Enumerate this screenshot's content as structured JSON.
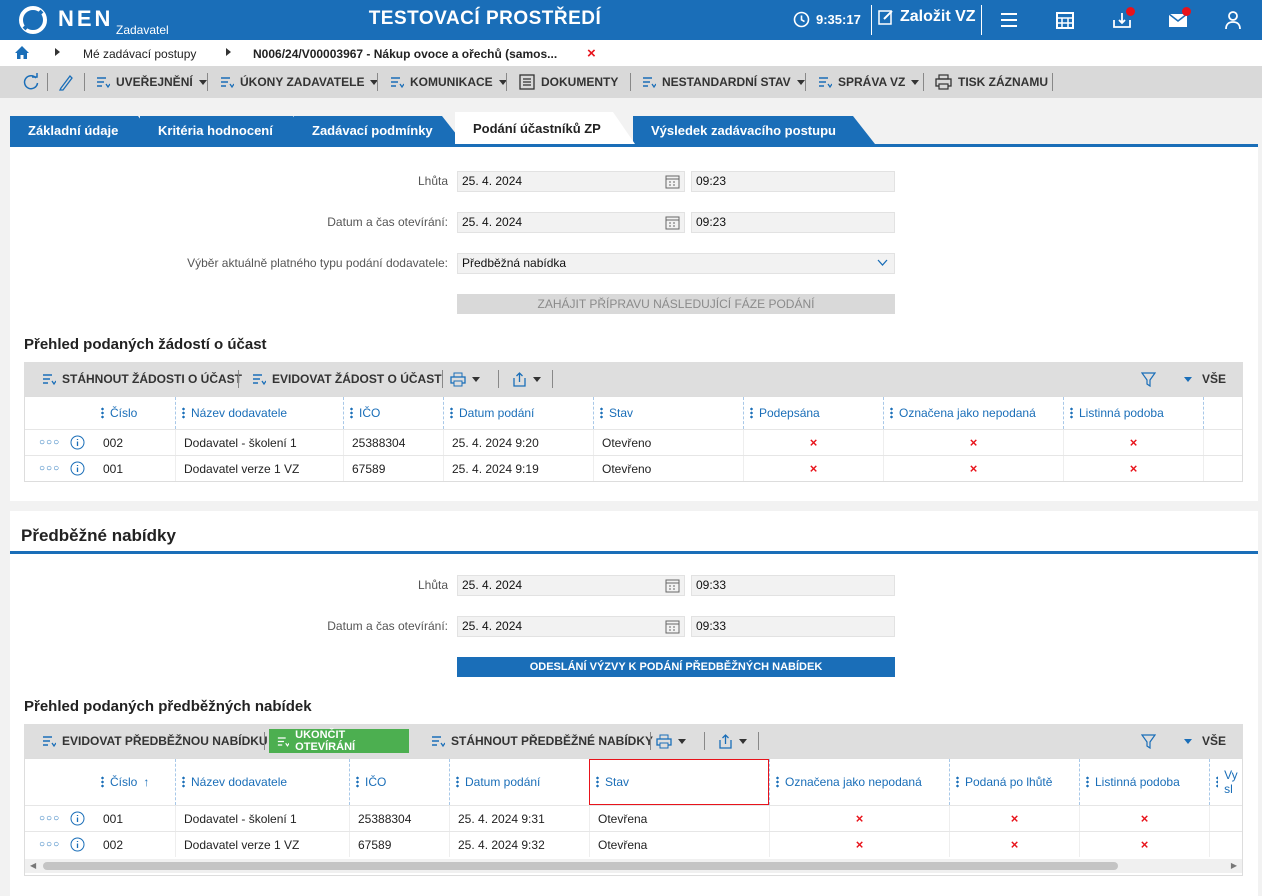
{
  "header": {
    "logo": "NEN",
    "logo_sub": "Zadavatel",
    "environment": "TESTOVACÍ PROSTŘEDÍ",
    "clock": "9:35:17",
    "new_button": "Založit VZ"
  },
  "breadcrumb": {
    "item1": "Mé zadávací postupy",
    "item2": "N006/24/V00003967 - Nákup ovoce a ořechů (samos..."
  },
  "toolbar": {
    "publish": "UVEŘEJNĚNÍ",
    "actions": "ÚKONY ZADAVATELE",
    "communication": "KOMUNIKACE",
    "documents": "DOKUMENTY",
    "nonstandard": "NESTANDARDNÍ STAV",
    "manage": "SPRÁVA VZ",
    "print": "TISK ZÁZNAMU"
  },
  "tabs": [
    "Základní údaje",
    "Kritéria hodnocení",
    "Zadávací podmínky",
    "Podání účastníků ZP",
    "Výsledek zadávacího postupu"
  ],
  "section1": {
    "deadline_label": "Lhůta",
    "deadline_date": "25. 4. 2024",
    "deadline_time": "09:23",
    "open_label": "Datum a čas otevírání:",
    "open_date": "25. 4. 2024",
    "open_time": "09:23",
    "type_label": "Výběr aktuálně platného typu podání dodavatele:",
    "type_value": "Předběžná nabídka",
    "prepare_button": "ZAHÁJIT PŘÍPRAVU NÁSLEDUJÍCÍ FÁZE PODÁNÍ",
    "grid_title": "Přehled podaných žádostí o účast",
    "btn_download": "STÁHNOUT ŽÁDOSTI O ÚČAST",
    "btn_register": "EVIDOVAT ŽÁDOST O ÚČAST",
    "all": "VŠE",
    "columns": [
      "Číslo",
      "Název dodavatele",
      "IČO",
      "Datum podání",
      "Stav",
      "Podepsána",
      "Označena jako nepodaná",
      "Listinná podoba"
    ],
    "rows": [
      {
        "num": "002",
        "name": "Dodavatel - školení 1",
        "ico": "25388304",
        "date": "25. 4. 2024 9:20",
        "state": "Otevřeno"
      },
      {
        "num": "001",
        "name": "Dodavatel verze 1 VZ",
        "ico": "67589",
        "date": "25. 4. 2024 9:19",
        "state": "Otevřeno"
      }
    ]
  },
  "section2": {
    "title": "Předběžné nabídky",
    "deadline_label": "Lhůta",
    "deadline_date": "25. 4. 2024",
    "deadline_time": "09:33",
    "open_label": "Datum a čas otevírání:",
    "open_date": "25. 4. 2024",
    "open_time": "09:33",
    "send_button": "ODESLÁNÍ VÝZVY K PODÁNÍ PŘEDBĚŽNÝCH NABÍDEK",
    "grid_title": "Přehled podaných předběžných nabídek",
    "btn_register": "EVIDOVAT PŘEDBĚŽNOU NABÍDKU",
    "btn_finish": "UKONČIT OTEVÍRÁNÍ",
    "btn_download": "STÁHNOUT PŘEDBĚŽNÉ NABÍDKY",
    "all": "VŠE",
    "columns": [
      "Číslo",
      "Název dodavatele",
      "IČO",
      "Datum podání",
      "Stav",
      "Označena jako nepodaná",
      "Podaná po lhůtě",
      "Listinná podoba",
      "Vy sl"
    ],
    "rows": [
      {
        "num": "001",
        "name": "Dodavatel - školení 1",
        "ico": "25388304",
        "date": "25. 4. 2024 9:31",
        "state": "Otevřena"
      },
      {
        "num": "002",
        "name": "Dodavatel verze 1 VZ",
        "ico": "67589",
        "date": "25. 4. 2024 9:32",
        "state": "Otevřena"
      }
    ]
  },
  "mark": "×"
}
